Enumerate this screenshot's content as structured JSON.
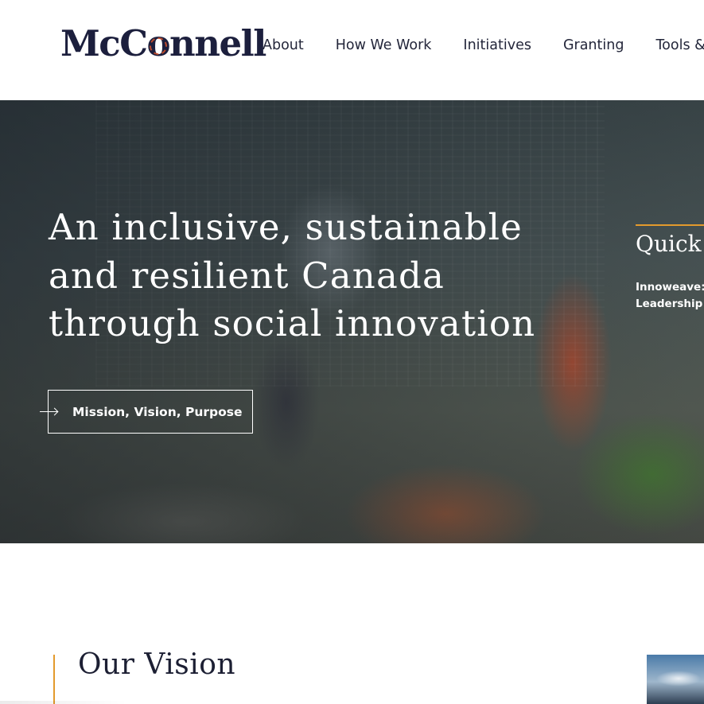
{
  "header": {
    "logo": {
      "text_before": "McC",
      "text_o": "o",
      "text_after": "nnell"
    },
    "nav": [
      "About",
      "How We Work",
      "Initiatives",
      "Granting",
      "Tools & Re"
    ]
  },
  "hero": {
    "heading": "An inclusive, sustainable and resilient Canada through social innovation",
    "cta_label": "Mission, Vision, Purpose",
    "quick_links": {
      "title": "Quick",
      "items": [
        "Innoweave:",
        "Leadership I"
      ]
    }
  },
  "vision": {
    "heading": "Our Vision"
  },
  "colors": {
    "brand_navy": "#1c1f3d",
    "accent_orange": "#e39a2d",
    "logo_ring": "#d9532b"
  }
}
